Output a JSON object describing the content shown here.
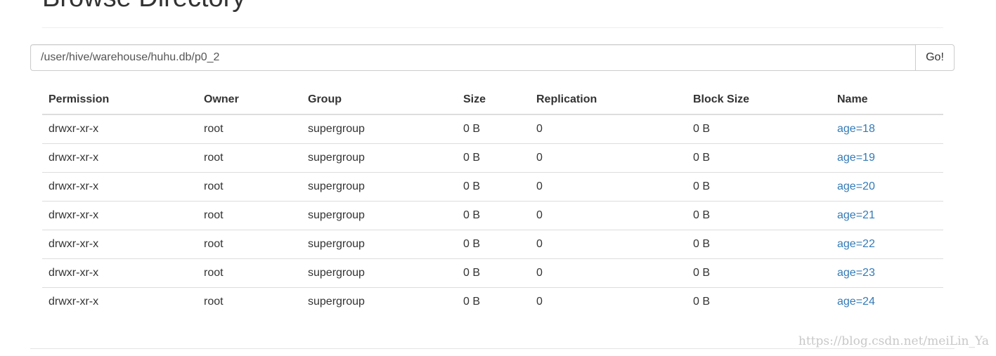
{
  "header": {
    "title": "Browse Directory"
  },
  "path_form": {
    "path_value": "/user/hive/warehouse/huhu.db/p0_2",
    "go_label": "Go!"
  },
  "table": {
    "columns": [
      "Permission",
      "Owner",
      "Group",
      "Size",
      "Replication",
      "Block Size",
      "Name"
    ],
    "rows": [
      {
        "permission": "drwxr-xr-x",
        "owner": "root",
        "group": "supergroup",
        "size": "0 B",
        "replication": "0",
        "block_size": "0 B",
        "name": "age=18"
      },
      {
        "permission": "drwxr-xr-x",
        "owner": "root",
        "group": "supergroup",
        "size": "0 B",
        "replication": "0",
        "block_size": "0 B",
        "name": "age=19"
      },
      {
        "permission": "drwxr-xr-x",
        "owner": "root",
        "group": "supergroup",
        "size": "0 B",
        "replication": "0",
        "block_size": "0 B",
        "name": "age=20"
      },
      {
        "permission": "drwxr-xr-x",
        "owner": "root",
        "group": "supergroup",
        "size": "0 B",
        "replication": "0",
        "block_size": "0 B",
        "name": "age=21"
      },
      {
        "permission": "drwxr-xr-x",
        "owner": "root",
        "group": "supergroup",
        "size": "0 B",
        "replication": "0",
        "block_size": "0 B",
        "name": "age=22"
      },
      {
        "permission": "drwxr-xr-x",
        "owner": "root",
        "group": "supergroup",
        "size": "0 B",
        "replication": "0",
        "block_size": "0 B",
        "name": "age=23"
      },
      {
        "permission": "drwxr-xr-x",
        "owner": "root",
        "group": "supergroup",
        "size": "0 B",
        "replication": "0",
        "block_size": "0 B",
        "name": "age=24"
      }
    ]
  },
  "watermark": {
    "text": "https://blog.csdn.net/meiLin_Ya"
  },
  "colors": {
    "link": "#337ab7",
    "text": "#333333",
    "border": "#dddddd"
  }
}
